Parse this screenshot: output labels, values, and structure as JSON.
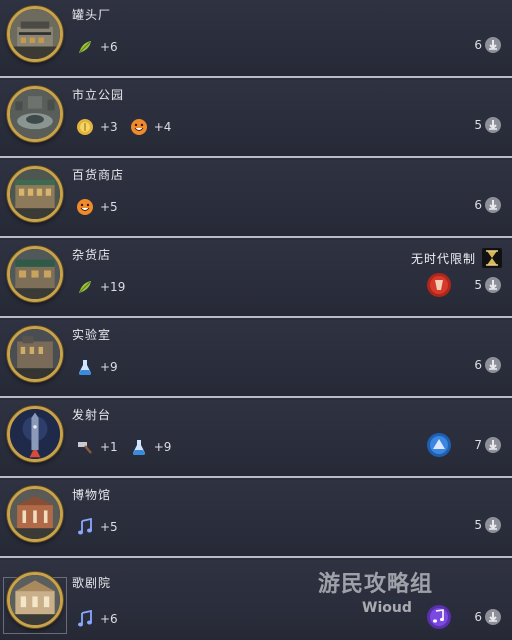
{
  "buildings": [
    {
      "name": "罐头厂",
      "yields": [
        {
          "icon": "food-icon",
          "value": "+6"
        }
      ],
      "cost": "6"
    },
    {
      "name": "市立公园",
      "yields": [
        {
          "icon": "gold-icon",
          "value": "+3"
        },
        {
          "icon": "happiness-icon",
          "value": "+4"
        }
      ],
      "cost": "5"
    },
    {
      "name": "百货商店",
      "yields": [
        {
          "icon": "happiness-icon",
          "value": "+5"
        }
      ],
      "cost": "6"
    },
    {
      "name": "杂货店",
      "yields": [
        {
          "icon": "food-icon",
          "value": "+19"
        }
      ],
      "cost": "5",
      "era_note": "无时代限制",
      "badge": "red-faction-badge"
    },
    {
      "name": "实验室",
      "yields": [
        {
          "icon": "science-icon",
          "value": "+9"
        }
      ],
      "cost": "6"
    },
    {
      "name": "发射台",
      "yields": [
        {
          "icon": "production-icon",
          "value": "+1"
        },
        {
          "icon": "science-icon",
          "value": "+9"
        }
      ],
      "cost": "7",
      "badge": "blue-faction-badge"
    },
    {
      "name": "博物馆",
      "yields": [
        {
          "icon": "culture-icon",
          "value": "+5"
        }
      ],
      "cost": "5"
    },
    {
      "name": "歌剧院",
      "yields": [
        {
          "icon": "culture-icon",
          "value": "+6"
        }
      ],
      "cost": "6",
      "badge": "purple-culture-badge"
    }
  ],
  "watermark": "游民攻略组",
  "watermark_sub": "Wioud"
}
